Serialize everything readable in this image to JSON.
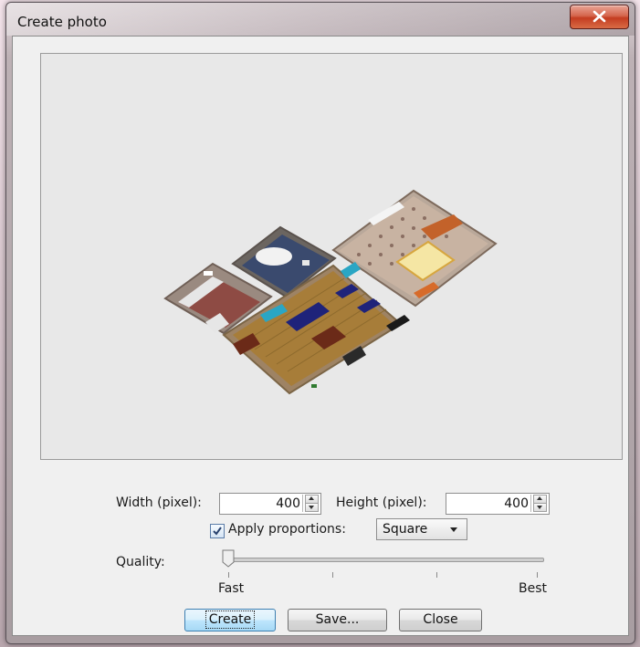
{
  "window": {
    "title": "Create photo"
  },
  "size": {
    "width_label": "Width (pixel):",
    "width_value": "400",
    "height_label": "Height (pixel):",
    "height_value": "400"
  },
  "proportions": {
    "checkbox_label": "Apply proportions:",
    "checked": true,
    "selected": "Square"
  },
  "quality": {
    "label": "Quality:",
    "min_label": "Fast",
    "max_label": "Best",
    "value_fraction": 0.0
  },
  "buttons": {
    "create": "Create",
    "save": "Save...",
    "close": "Close"
  },
  "colors": {
    "close_button": "#c43d21",
    "preview_bg": "#e8e8e8",
    "default_button": "#3c7fb1"
  }
}
